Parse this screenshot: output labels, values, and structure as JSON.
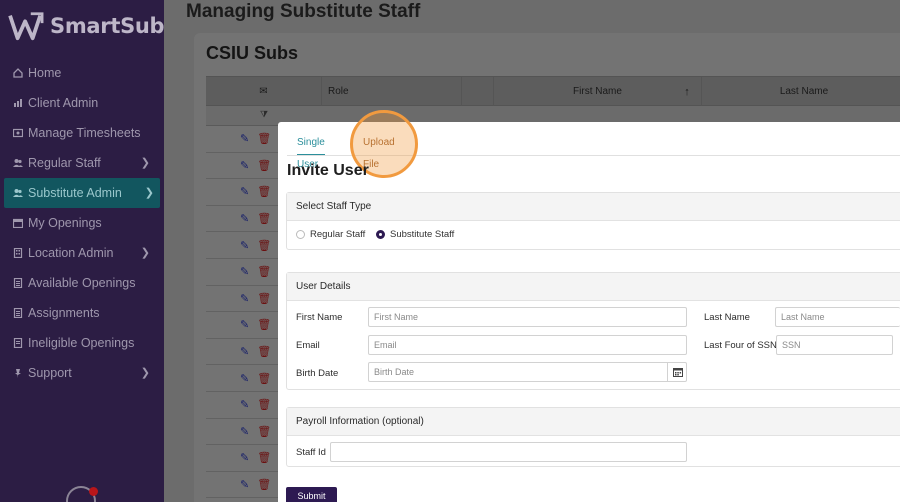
{
  "app": {
    "name": "SmartSub"
  },
  "page": {
    "title": "Managing Substitute Staff"
  },
  "sidebar": {
    "items": [
      {
        "label": "Home",
        "icon": "home-icon"
      },
      {
        "label": "Client Admin",
        "icon": "chart-icon"
      },
      {
        "label": "Manage Timesheets",
        "icon": "timesheet-icon"
      },
      {
        "label": "Regular Staff",
        "icon": "users-icon"
      },
      {
        "label": "Substitute Admin",
        "icon": "users-icon"
      },
      {
        "label": "My Openings",
        "icon": "calendar-icon"
      },
      {
        "label": "Location Admin",
        "icon": "building-icon"
      },
      {
        "label": "Available Openings",
        "icon": "file-icon"
      },
      {
        "label": "Assignments",
        "icon": "file-icon"
      },
      {
        "label": "Ineligible Openings",
        "icon": "file-icon"
      },
      {
        "label": "Support",
        "icon": "pin-icon"
      }
    ]
  },
  "card": {
    "title": "CSIU Subs"
  },
  "grid": {
    "columns": [
      "Role",
      "First Name",
      "Last Name"
    ],
    "row_count": 14
  },
  "modal": {
    "tabs": {
      "single": "Single User",
      "upload": "Upload File"
    },
    "title": "Invite User",
    "staff_type": {
      "heading": "Select Staff Type",
      "options": [
        "Regular Staff",
        "Substitute Staff"
      ],
      "selected": "Substitute Staff"
    },
    "user_details": {
      "heading": "User Details",
      "first_name_label": "First Name",
      "first_name_placeholder": "First Name",
      "last_name_label": "Last Name",
      "last_name_placeholder": "Last Name",
      "email_label": "Email",
      "email_placeholder": "Email",
      "ssn_label": "Last Four of SSN",
      "ssn_placeholder": "SSN",
      "birth_label": "Birth Date",
      "birth_placeholder": "Birth Date"
    },
    "payroll": {
      "heading": "Payroll Information (optional)",
      "staff_id_label": "Staff Id"
    },
    "submit_label": "Submit"
  },
  "colors": {
    "sidebar": "#2c1d44",
    "active": "#12565f",
    "accent": "#2b8f9b",
    "highlight": "#f19a3f",
    "primary_button": "#2d1a52"
  }
}
